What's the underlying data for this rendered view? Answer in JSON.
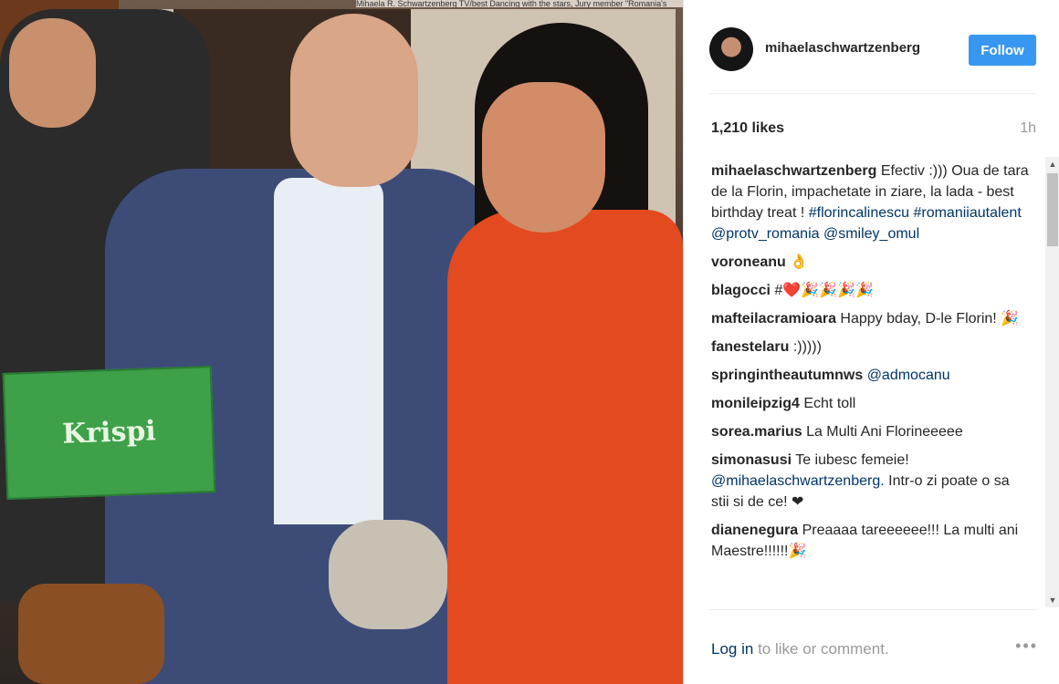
{
  "photo": {
    "caption_text": "Mihaela R. Schwartzenberg TV/best Dancing with the stars, Jury member \"Romania's",
    "box_text": "Krispi"
  },
  "post": {
    "username": "mihaelaschwartzenberg",
    "follow_label": "Follow",
    "likes": "1,210 likes",
    "time": "1h",
    "caption": {
      "author": "mihaelaschwartzenberg",
      "text": "Efectiv :))) Oua de tara de la Florin, impachetate in ziare, la lada - best birthday treat !",
      "tags": "#florincalinescu #romaniiautalent",
      "mentions": "@protv_romania @smiley_omul"
    },
    "comments": [
      {
        "author": "voroneanu",
        "text": "👌"
      },
      {
        "author": "blagocci",
        "text": "#❤️🎉🎉🎉🎉"
      },
      {
        "author": "mafteilacramioara",
        "text": "Happy bday, D-le Florin! 🎉"
      },
      {
        "author": "fanestelaru",
        "text": ":)))))"
      },
      {
        "author": "springintheautumnws",
        "text": "@admocanu",
        "is_link": true
      },
      {
        "author": "monileipzig4",
        "text": "Echt toll"
      },
      {
        "author": "sorea.marius",
        "text": "La Multi Ani Florineeeee"
      },
      {
        "author": "simonasusi",
        "text": "Te iubesc femeie!",
        "mention": "@mihaelaschwartzenberg.",
        "tail": "Intr-o zi poate o sa stii si de ce! ❤"
      },
      {
        "author": "dianenegura",
        "text": "Preaaaa tareeeeee!!! La multi ani Maestre!!!!!!🎉"
      }
    ],
    "login_link": "Log in",
    "login_text": "to like or comment.",
    "more_label": "•••"
  }
}
